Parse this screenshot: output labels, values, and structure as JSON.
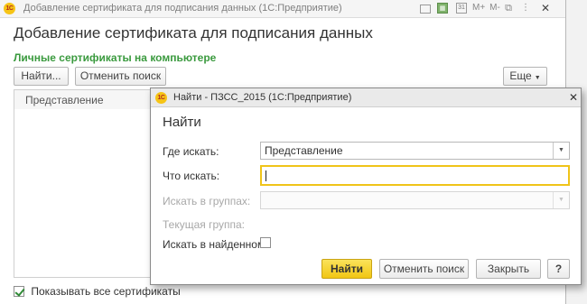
{
  "main_window": {
    "title": "Добавление сертификата для подписания данных  (1С:Предприятие)",
    "logo_text": "1С",
    "page_title": "Добавление сертификата для подписания данных",
    "section_label": "Личные сертификаты на компьютере",
    "toolbar": {
      "find_label": "Найти...",
      "cancel_search_label": "Отменить поиск",
      "more_label": "Еще",
      "more_caret": "▼"
    },
    "table": {
      "column_header": "Представление"
    },
    "show_all": {
      "label": "Показывать все сертификаты",
      "checked": true
    },
    "title_icons": [
      "printer-icon",
      "grid-icon",
      "calendar-icon",
      "memory-plus-icon",
      "memory-minus-icon",
      "link-icon",
      "more-icon",
      "close-icon"
    ],
    "icon_glyphs": {
      "cal": "31",
      "grid": "▦",
      "mplus": "M+",
      "mminus": "M-",
      "link": "⧉",
      "more": "⋮",
      "close": "✕"
    }
  },
  "find_dialog": {
    "title": "Найти - ПЗСС_2015  (1С:Предприятие)",
    "logo_text": "1С",
    "close_glyph": "✕",
    "heading": "Найти",
    "fields": {
      "where_label": "Где искать:",
      "where_value": "Представление",
      "what_label": "Что искать:",
      "what_value": "",
      "groups_label": "Искать в группах:",
      "groups_value": "",
      "current_group_label": "Текущая группа:",
      "search_in_found_label": "Искать в найденном:",
      "search_in_found_checked": false
    },
    "dropdown_caret": "▼",
    "buttons": {
      "find": "Найти",
      "cancel_search": "Отменить поиск",
      "close": "Закрыть",
      "help": "?"
    }
  },
  "colors": {
    "section_label": "#3a9a3e",
    "primary_button": "#f1c613",
    "focus_border": "#f0c419",
    "logo": "#f6c416"
  }
}
